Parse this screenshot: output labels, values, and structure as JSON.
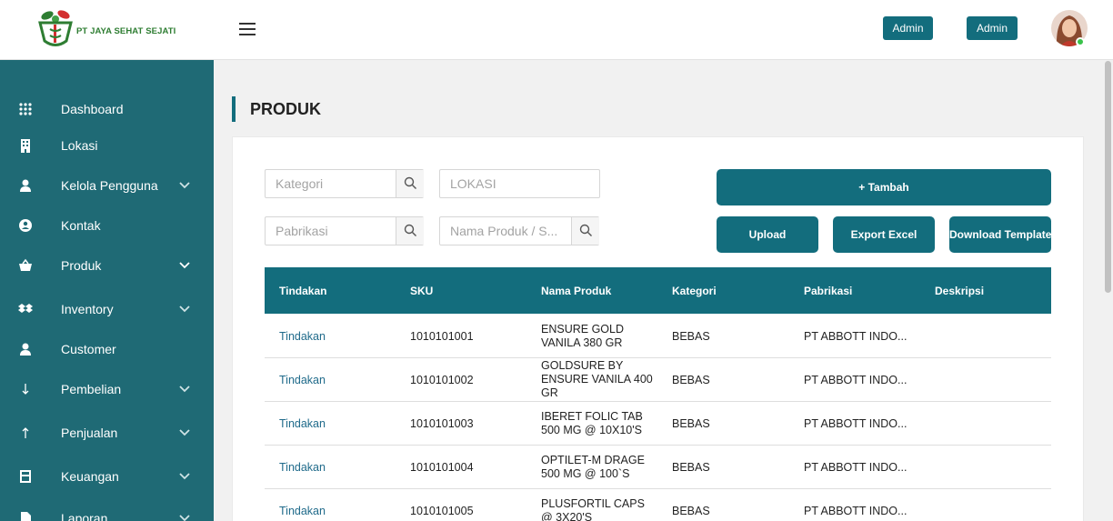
{
  "app": {
    "company_name": "PT JAYA SEHAT SEJATI",
    "user_button_1": "Admin",
    "user_button_2": "Admin"
  },
  "sidebar": {
    "items": [
      {
        "label": "Dashboard",
        "icon": "grid-icon",
        "has_submenu": false
      },
      {
        "label": "Lokasi",
        "icon": "building-icon",
        "has_submenu": false
      },
      {
        "label": "Kelola Pengguna",
        "icon": "user-icon",
        "has_submenu": true
      },
      {
        "label": "Kontak",
        "icon": "contact-icon",
        "has_submenu": false
      },
      {
        "label": "Produk",
        "icon": "basket-icon",
        "has_submenu": true
      },
      {
        "label": "Inventory",
        "icon": "dropbox-icon",
        "has_submenu": true
      },
      {
        "label": "Customer",
        "icon": "user-icon",
        "has_submenu": false
      },
      {
        "label": "Pembelian",
        "icon": "arrow-down-icon",
        "has_submenu": true
      },
      {
        "label": "Penjualan",
        "icon": "arrow-up-icon",
        "has_submenu": true
      },
      {
        "label": "Keuangan",
        "icon": "calculator-icon",
        "has_submenu": true
      },
      {
        "label": "Laporan",
        "icon": "file-icon",
        "has_submenu": true
      }
    ]
  },
  "page": {
    "title": "PRODUK"
  },
  "filters": {
    "kategori_placeholder": "Kategori",
    "lokasi_placeholder": "LOKASI",
    "pabrikasi_placeholder": "Pabrikasi",
    "nama_placeholder": "Nama Produk / S..."
  },
  "actions": {
    "tambah": "+ Tambah",
    "upload": "Upload",
    "export": "Export Excel",
    "download": "Download Template"
  },
  "table": {
    "headers": [
      "Tindakan",
      "SKU",
      "Nama Produk",
      "Kategori",
      "Pabrikasi",
      "Deskripsi"
    ],
    "rows": [
      {
        "action": "Tindakan",
        "sku": "1010101001",
        "name": "ENSURE GOLD VANILA 380 GR",
        "kategori": "BEBAS",
        "pabrikasi": "PT ABBOTT INDO...",
        "deskripsi": ""
      },
      {
        "action": "Tindakan",
        "sku": "1010101002",
        "name": "GOLDSURE BY ENSURE VANILA 400 GR",
        "kategori": "BEBAS",
        "pabrikasi": "PT ABBOTT INDO...",
        "deskripsi": ""
      },
      {
        "action": "Tindakan",
        "sku": "1010101003",
        "name": "IBERET FOLIC TAB 500 MG @ 10X10'S",
        "kategori": "BEBAS",
        "pabrikasi": "PT ABBOTT INDO...",
        "deskripsi": ""
      },
      {
        "action": "Tindakan",
        "sku": "1010101004",
        "name": "OPTILET-M DRAGE 500 MG @ 100`S",
        "kategori": "BEBAS",
        "pabrikasi": "PT ABBOTT INDO...",
        "deskripsi": ""
      },
      {
        "action": "Tindakan",
        "sku": "1010101005",
        "name": "PLUSFORTIL CAPS @ 3X20'S",
        "kategori": "BEBAS",
        "pabrikasi": "PT ABBOTT INDO...",
        "deskripsi": ""
      }
    ]
  },
  "colors": {
    "primary": "#136d7d",
    "sidebar": "#1f6a75",
    "link": "#1f6a8a",
    "logo_green": "#2e7d32",
    "logo_red": "#d32f2f",
    "online": "#39c24a"
  }
}
